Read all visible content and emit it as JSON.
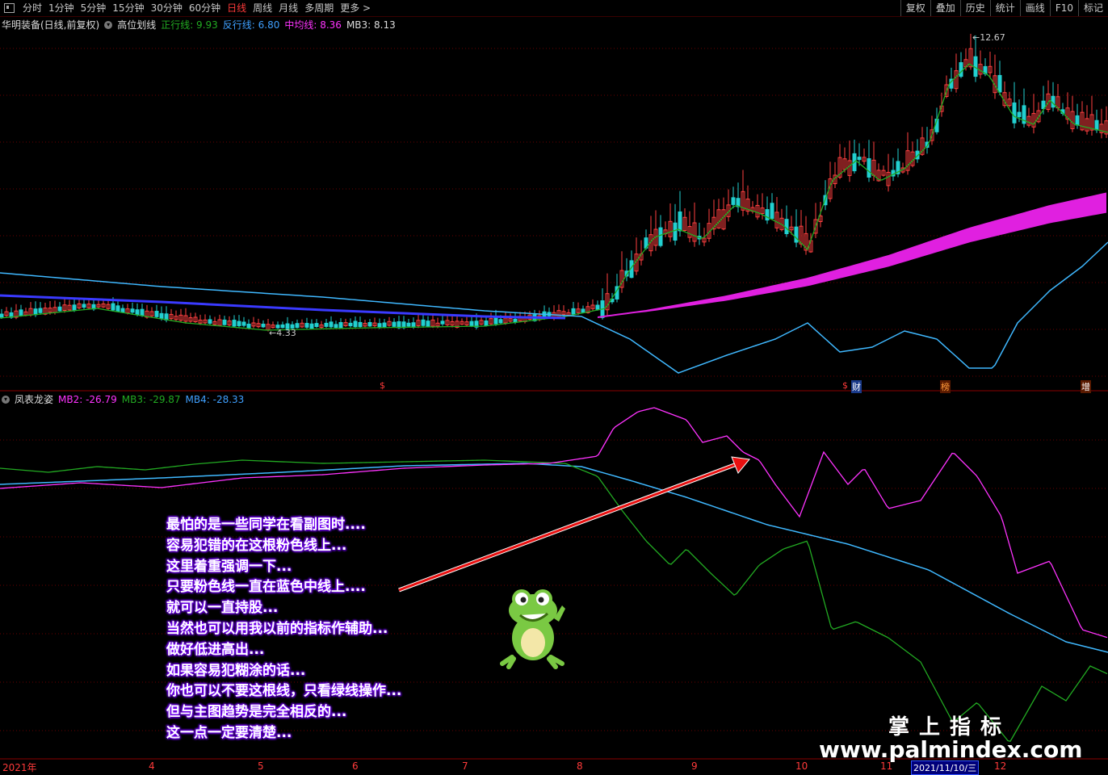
{
  "toolbar": {
    "left": [
      "分时",
      "1分钟",
      "5分钟",
      "15分钟",
      "30分钟",
      "60分钟",
      "日线",
      "周线",
      "月线",
      "多周期",
      "更多 >"
    ],
    "active": "日线",
    "right": [
      "复权",
      "叠加",
      "历史",
      "统计",
      "画线",
      "F10",
      "标记"
    ]
  },
  "main_legend": {
    "stock": "华明装备(日线,前复权)",
    "indicator": "高位划线",
    "items": [
      {
        "label": "正行线: 9.93",
        "color": "#22aa22"
      },
      {
        "label": "反行线: 6.80",
        "color": "#3fa0ff"
      },
      {
        "label": "中均线: 8.36",
        "color": "#ff33ff"
      },
      {
        "label": "MB3: 8.13",
        "color": "#dcdcdc"
      }
    ]
  },
  "sub_legend": {
    "indicator": "凤表龙姿",
    "items": [
      {
        "label": "MB2: -26.79",
        "color": "#ff33ff"
      },
      {
        "label": "MB3: -29.87",
        "color": "#22aa22"
      },
      {
        "label": "MB4: -28.33",
        "color": "#3fa0ff"
      }
    ]
  },
  "price_labels": {
    "high": "12.67",
    "low": "4.33"
  },
  "events": [
    {
      "text": "$",
      "color": "#ff3a3a"
    },
    {
      "text": "$",
      "color": "#ff3a3a"
    },
    {
      "text": "财",
      "color": "#fff"
    },
    {
      "text": "榜",
      "color": "#ff9a3a"
    },
    {
      "text": "增",
      "color": "#fff"
    }
  ],
  "note_lines": [
    "最怕的是一些同学在看副图时....",
    "容易犯错的在这根粉色线上...",
    "这里着重强调一下...",
    "只要粉色线一直在蓝色中线上....",
    "就可以一直持股...",
    "当然也可以用我以前的指标作辅助...",
    "做好低进高出...",
    "如果容易犯糊涂的话...",
    "你也可以不要这根线，只看绿线操作...",
    "但与主图趋势是完全相反的...",
    "这一点一定要清楚..."
  ],
  "watermark": {
    "cn": "掌上指标",
    "url": "www.palmindex.com"
  },
  "time_axis": {
    "labels": [
      "2021年",
      "4",
      "5",
      "6",
      "7",
      "8",
      "9",
      "10",
      "11",
      "12"
    ],
    "cursor_date": "2021/11/10/三"
  }
}
